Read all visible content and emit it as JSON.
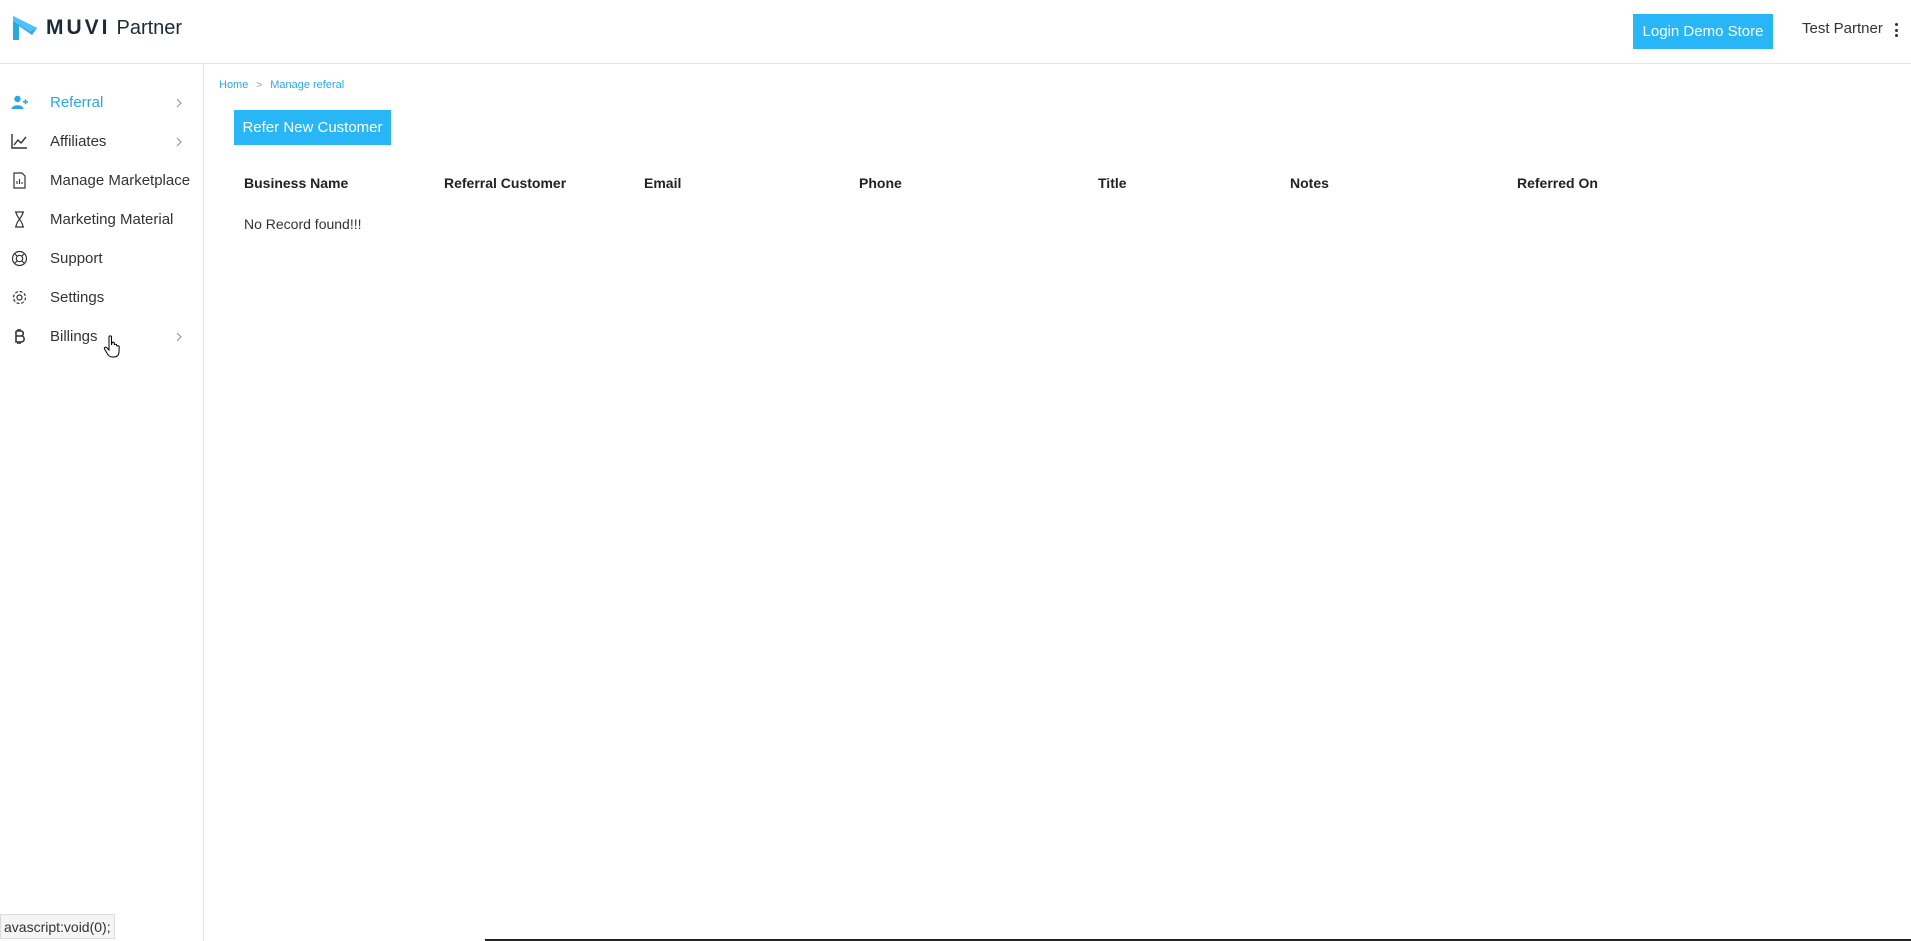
{
  "header": {
    "brand": "MUVI",
    "brand_suffix": "Partner",
    "demo_button": "Login Demo Store",
    "user_name": "Test Partner",
    "colors": {
      "accent": "#29b6f6",
      "logo": "#29a9e0",
      "text": "#1f2a37"
    }
  },
  "sidebar": {
    "items": [
      {
        "label": "Referral",
        "icon": "user-plus-icon",
        "active": true,
        "has_submenu": true
      },
      {
        "label": "Affiliates",
        "icon": "chart-line-icon",
        "active": false,
        "has_submenu": true
      },
      {
        "label": "Manage Marketplace",
        "icon": "document-icon",
        "active": false,
        "has_submenu": false
      },
      {
        "label": "Marketing Material",
        "icon": "hourglass-icon",
        "active": false,
        "has_submenu": false
      },
      {
        "label": "Support",
        "icon": "lifebuoy-icon",
        "active": false,
        "has_submenu": false
      },
      {
        "label": "Settings",
        "icon": "gear-icon",
        "active": false,
        "has_submenu": false
      },
      {
        "label": "Billings",
        "icon": "bitcoin-icon",
        "active": false,
        "has_submenu": true
      }
    ]
  },
  "breadcrumb": {
    "home": "Home",
    "separator": ">",
    "current": "Manage referal"
  },
  "main": {
    "refer_button": "Refer New Customer",
    "table": {
      "columns": [
        "Business Name",
        "Referral Customer",
        "Email",
        "Phone",
        "Title",
        "Notes",
        "Referred On"
      ],
      "empty_message": "No Record found!!!"
    }
  },
  "status_bar": "avascript:void(0);"
}
